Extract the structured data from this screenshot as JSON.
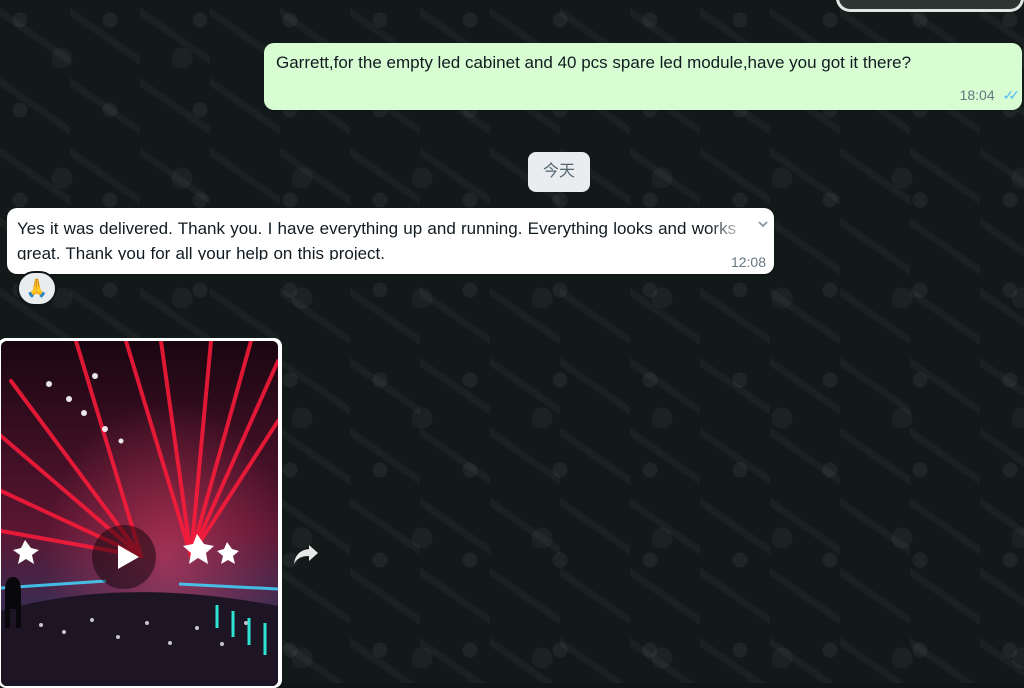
{
  "chat": {
    "outgoing_message": {
      "text": "Garrett,for the empty led cabinet and 40 pcs spare led module,have you got it there?",
      "time": "18:04",
      "status_icon": "double-check-icon"
    },
    "date_divider": "今天",
    "incoming_message": {
      "text": "Yes it was delivered.  Thank you.  I have everything up and running.  Everything looks and works great.  Thank you for all your help on this project.",
      "time": "12:08",
      "reaction": "🙏"
    },
    "video_message": {
      "play_icon": "play-icon",
      "forward_icon": "forward-icon"
    }
  },
  "colors": {
    "background": "#121a19",
    "outgoing_bubble": "#d9fdd3",
    "incoming_bubble": "#ffffff",
    "date_chip": "#e9edef",
    "read_ticks": "#53bdeb",
    "laser_red": "#ff1b3a"
  }
}
